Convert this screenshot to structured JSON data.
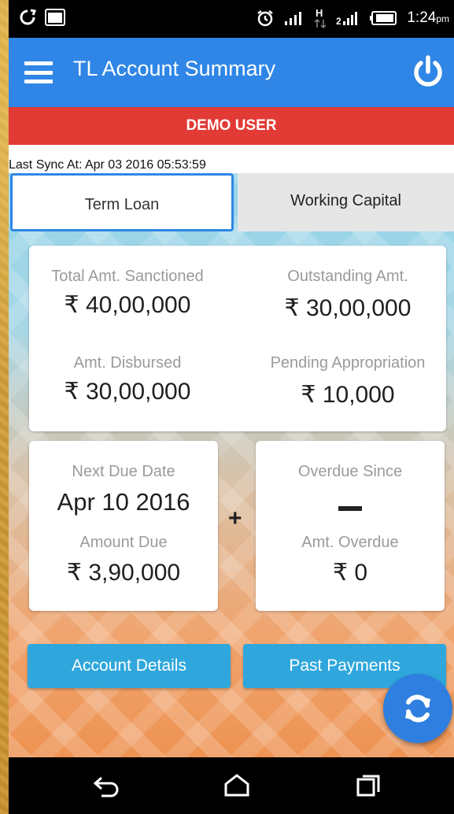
{
  "status_bar": {
    "time": "1:24",
    "ampm": "pm",
    "icons": [
      "sync-icon",
      "image-icon",
      "alarm-icon",
      "signal-icon",
      "data-h-icon",
      "signal-2-icon",
      "battery-icon"
    ]
  },
  "app_bar": {
    "title": "TL Account Summary",
    "menu_icon": "menu-icon",
    "power_icon": "power-icon",
    "color": "#2f86e6"
  },
  "user_banner": {
    "text": "DEMO USER",
    "color": "#e23a35"
  },
  "sync": {
    "text": "Last Sync At: Apr 03 2016 05:53:59"
  },
  "tabs": [
    {
      "label": "Term Loan",
      "active": true
    },
    {
      "label": "Working Capital",
      "active": false
    }
  ],
  "summary": {
    "total_sanctioned_label": "Total Amt. Sanctioned",
    "total_sanctioned_value": "₹ 40,00,000",
    "outstanding_label": "Outstanding Amt.",
    "outstanding_value": "₹ 30,00,000",
    "disbursed_label": "Amt. Disbursed",
    "disbursed_value": "₹ 30,00,000",
    "pending_label": "Pending Appropriation",
    "pending_value": "₹ 10,000"
  },
  "due": {
    "next_due_label": "Next Due Date",
    "next_due_value": "Apr 10 2016",
    "amount_due_label": "Amount Due",
    "amount_due_value": "₹ 3,90,000",
    "plus_sign": "+"
  },
  "overdue": {
    "since_label": "Overdue Since",
    "amt_label": "Amt. Overdue",
    "amt_value": "₹ 0"
  },
  "buttons": {
    "account_details": "Account Details",
    "past_payments": "Past Payments",
    "color": "#2fa7dd"
  },
  "fab": {
    "icon": "refresh-icon"
  },
  "nav": {
    "icons": [
      "back-icon",
      "home-icon",
      "recents-icon"
    ]
  }
}
